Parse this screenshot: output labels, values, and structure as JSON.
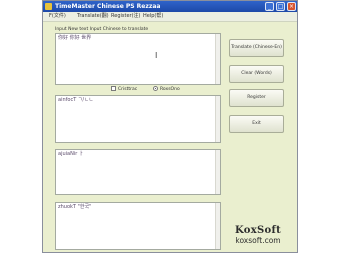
{
  "window": {
    "title": "TimeMaster Chinese PS Rezzaa",
    "controls": {
      "minimize": "_",
      "maximize": "□",
      "close": "×"
    }
  },
  "menu": {
    "items": [
      "F(文件)",
      "Translate(翻)",
      "Register(注)",
      "Help(帮)"
    ]
  },
  "input": {
    "caption": "Input New text Input Chinese to translate",
    "text": "你好 你好 世界"
  },
  "options": {
    "checkbox_label": "Cristtrac",
    "radio_label": "RoxsOno",
    "radio_selected": true
  },
  "outputs": [
    {
      "text": "ainfocT ㄱ/ㄴㄴ"
    },
    {
      "text": "ajuiaNir ㅏ"
    },
    {
      "text": "zhuokT  \"한국\""
    }
  ],
  "buttons": {
    "translate": "Translate (Chinese-En)",
    "clear": "Clear (Words)",
    "register": "Register",
    "exit": "Exit"
  },
  "brand": {
    "logo": "KoxSoft",
    "url": "koxsoft.com"
  }
}
